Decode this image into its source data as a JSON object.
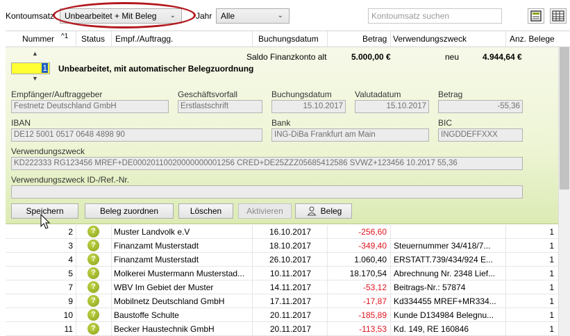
{
  "toolbar": {
    "kontoumsatz_label": "Kontoumsatz",
    "filter_value": "Unbearbeitet + Mit Beleg",
    "jahr_label": "Jahr",
    "jahr_value": "Alle",
    "search_placeholder": "Kontoumsatz suchen",
    "highlight_color": "#b2171d"
  },
  "columns": {
    "nummer": "Nummer",
    "sort_indicator": "^1",
    "status": "Status",
    "empf": "Empf./Auftragg.",
    "buchungsdatum": "Buchungsdatum",
    "betrag": "Betrag",
    "verwendungszweck": "Verwendungszweck",
    "anz_belege": "Anz. Belege"
  },
  "detail": {
    "saldo_label": "Saldo Finanzkonto alt",
    "saldo_value": "5.000,00 €",
    "neu_label": "neu",
    "neu_value": "4.944,64 €",
    "number_value": "1",
    "title": "Unbearbeitet, mit automatischer Belegzuordnung",
    "empfaenger_label": "Empfänger/Auftraggeber",
    "empfaenger_value": "Festnetz Deutschland GmbH",
    "geschaeftsvorfall_label": "Geschäftsvorfall",
    "geschaeftsvorfall_value": "Erstlastschrift",
    "buchungsdatum_label": "Buchungsdatum",
    "buchungsdatum_value": "15.10.2017",
    "valutadatum_label": "Valutadatum",
    "valutadatum_value": "15.10.2017",
    "betrag_label": "Betrag",
    "betrag_value": "-55,36",
    "iban_label": "IBAN",
    "iban_value": "DE12 5001 0517 0648 4898 90",
    "bank_label": "Bank",
    "bank_value": "ING-DiBa Frankfurt am Main",
    "bic_label": "BIC",
    "bic_value": "INGDDEFFXXX",
    "verwendungszweck_label": "Verwendungszweck",
    "verwendungszweck_value": "KD222333 RG123456 MREF+DE00020110020000000001256 CRED+DE25ZZZ05685412586 SVWZ+123456 10.2017 55,36",
    "verwendungszweck_id_label": "Verwendungszweck ID-/Ref.-Nr.",
    "verwendungszweck_id_value": "",
    "buttons": {
      "speichern": "Speichern",
      "beleg_zuordnen": "Beleg zuordnen",
      "loeschen": "Löschen",
      "aktivieren": "Aktivieren",
      "beleg": "Beleg"
    }
  },
  "rows": [
    {
      "nummer": "2",
      "status": "?",
      "empf": "Muster Landvolk e.V",
      "datum": "16.10.2017",
      "betrag": "-256,60",
      "zweck": "",
      "belege": "1",
      "negative": true
    },
    {
      "nummer": "3",
      "status": "?",
      "empf": "Finanzamt Musterstadt",
      "datum": "18.10.2017",
      "betrag": "-349,40",
      "zweck": "Steuernummer 34/418/7...",
      "belege": "1",
      "negative": true
    },
    {
      "nummer": "4",
      "status": "?",
      "empf": "Finanzamt Musterstadt",
      "datum": "26.10.2017",
      "betrag": "1.060,40",
      "zweck": "ERSTATT.739/434/924 E...",
      "belege": "1",
      "negative": false
    },
    {
      "nummer": "5",
      "status": "?",
      "empf": "Molkerei Mustermann Musterstad...",
      "datum": "10.11.2017",
      "betrag": "18.170,54",
      "zweck": "Abrechnung Nr. 2348 Lief...",
      "belege": "1",
      "negative": false
    },
    {
      "nummer": "7",
      "status": "?",
      "empf": "WBV Im Gebiet der Muster",
      "datum": "14.11.2017",
      "betrag": "-53,12",
      "zweck": "Beitrags-Nr.: 57874",
      "belege": "1",
      "negative": true
    },
    {
      "nummer": "9",
      "status": "?",
      "empf": "Mobilnetz Deutschland GmbH",
      "datum": "17.11.2017",
      "betrag": "-17,87",
      "zweck": "Kd334455 MREF+MR334...",
      "belege": "1",
      "negative": true
    },
    {
      "nummer": "10",
      "status": "?",
      "empf": "Baustoffe Schulte",
      "datum": "20.11.2017",
      "betrag": "-185,89",
      "zweck": "Kunde D134984 Belegnu...",
      "belege": "1",
      "negative": true
    },
    {
      "nummer": "11",
      "status": "?",
      "empf": "Becker Haustechnik GmbH",
      "datum": "20.11.2017",
      "betrag": "-113,53",
      "zweck": "Kd. 149, RE 160846",
      "belege": "1",
      "negative": true
    }
  ],
  "colors": {
    "negative": "#e0141e",
    "status_icon": "#8aa21a",
    "detail_background": "#eef5d6",
    "number_highlight": "#ffff33"
  }
}
